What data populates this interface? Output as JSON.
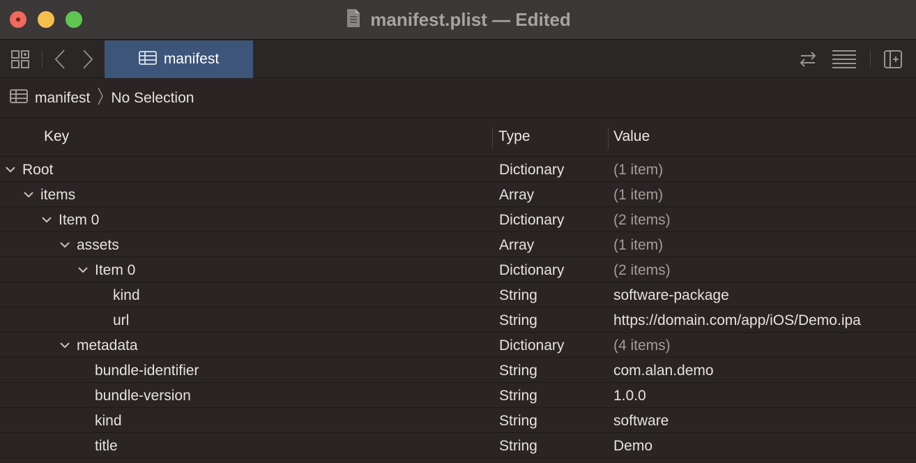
{
  "window": {
    "title": "manifest.plist — Edited",
    "file_icon": "document-icon"
  },
  "toolbar": {
    "grid_icon": "related-items-icon",
    "back_icon": "chevron-left-icon",
    "forward_icon": "chevron-right-icon",
    "tab_label": "manifest",
    "tab_icon": "table-icon",
    "right_icons": [
      "swap-arrows-icon",
      "list-lines-icon",
      "add-editor-icon"
    ],
    "tab_color": "#3d5578"
  },
  "jumpbar": {
    "file_label": "manifest",
    "selection_label": "No Selection"
  },
  "table": {
    "headers": {
      "key": "Key",
      "type": "Type",
      "value": "Value"
    },
    "rows": [
      {
        "key": "Root",
        "type": "Dictionary",
        "value": "(1 item)",
        "depth": 0,
        "expandable": true,
        "muted": true
      },
      {
        "key": "items",
        "type": "Array",
        "value": "(1 item)",
        "depth": 1,
        "expandable": true,
        "muted": true
      },
      {
        "key": "Item 0",
        "type": "Dictionary",
        "value": "(2 items)",
        "depth": 2,
        "expandable": true,
        "muted": true
      },
      {
        "key": "assets",
        "type": "Array",
        "value": "(1 item)",
        "depth": 3,
        "expandable": true,
        "muted": true
      },
      {
        "key": "Item 0",
        "type": "Dictionary",
        "value": "(2 items)",
        "depth": 4,
        "expandable": true,
        "muted": true
      },
      {
        "key": "kind",
        "type": "String",
        "value": "software-package",
        "depth": 5,
        "expandable": false,
        "muted": false
      },
      {
        "key": "url",
        "type": "String",
        "value": "https://domain.com/app/iOS/Demo.ipa",
        "depth": 5,
        "expandable": false,
        "muted": false
      },
      {
        "key": "metadata",
        "type": "Dictionary",
        "value": "(4 items)",
        "depth": 3,
        "expandable": true,
        "muted": true
      },
      {
        "key": "bundle-identifier",
        "type": "String",
        "value": "com.alan.demo",
        "depth": 4,
        "expandable": false,
        "muted": false
      },
      {
        "key": "bundle-version",
        "type": "String",
        "value": "1.0.0",
        "depth": 4,
        "expandable": false,
        "muted": false
      },
      {
        "key": "kind",
        "type": "String",
        "value": "software",
        "depth": 4,
        "expandable": false,
        "muted": false
      },
      {
        "key": "title",
        "type": "String",
        "value": "Demo",
        "depth": 4,
        "expandable": false,
        "muted": false
      }
    ]
  }
}
